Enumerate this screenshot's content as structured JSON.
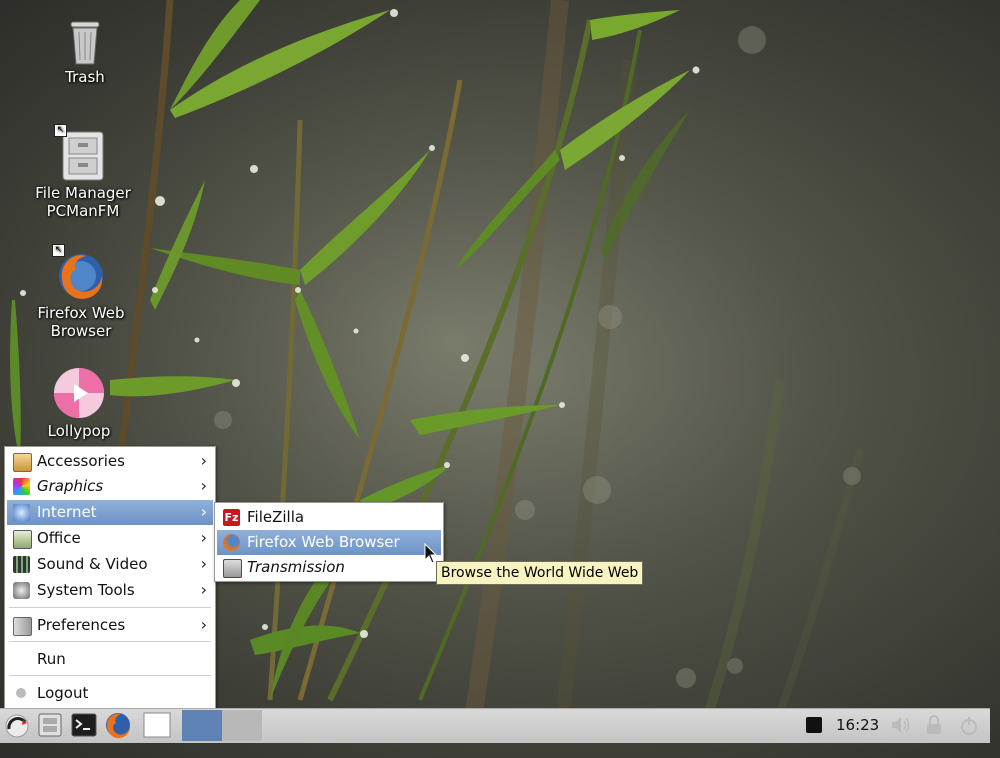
{
  "desktop": {
    "icons": [
      {
        "label": "Trash",
        "icon": "trash-icon"
      },
      {
        "label": "File Manager PCManFM",
        "icon": "file-manager-icon"
      },
      {
        "label": "Firefox Web Browser",
        "icon": "firefox-icon"
      },
      {
        "label": "Lollypop",
        "icon": "lollypop-icon"
      }
    ]
  },
  "main_menu": {
    "items": [
      {
        "label": "Accessories",
        "icon": "accessories-icon"
      },
      {
        "label": "Graphics",
        "icon": "graphics-icon"
      },
      {
        "label": "Internet",
        "icon": "internet-icon"
      },
      {
        "label": "Office",
        "icon": "office-icon"
      },
      {
        "label": "Sound & Video",
        "icon": "sound-video-icon"
      },
      {
        "label": "System Tools",
        "icon": "system-tools-icon"
      },
      {
        "label": "Preferences",
        "icon": "preferences-icon"
      },
      {
        "label": "Run"
      },
      {
        "label": "Logout",
        "icon": "logout-icon"
      }
    ],
    "selected": "Internet"
  },
  "internet_submenu": {
    "items": [
      {
        "label": "FileZilla",
        "icon": "filezilla-icon"
      },
      {
        "label": "Firefox Web Browser",
        "icon": "firefox-icon"
      },
      {
        "label": "Transmission",
        "icon": "transmission-icon"
      }
    ],
    "selected": "Firefox Web Browser"
  },
  "tooltip": {
    "text": "Browse the World Wide Web"
  },
  "taskbar": {
    "clock": "16:23",
    "launchers": [
      "menu-icon",
      "file-manager-icon",
      "terminal-icon",
      "firefox-icon",
      "blank-window-icon"
    ]
  },
  "colors": {
    "selection": "#6d93c6",
    "tooltip_bg": "#f8f4c2",
    "panel": "#cfcfcf"
  }
}
